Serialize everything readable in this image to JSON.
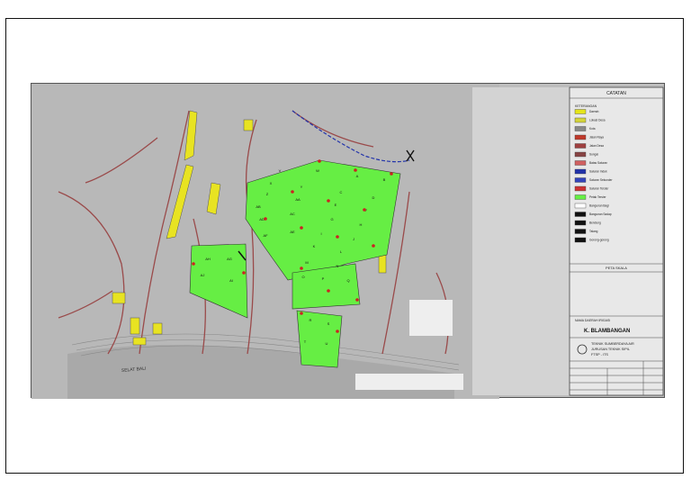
{
  "legend": {
    "title": "CATATAN",
    "subtitle": "KETERANGAN",
    "items": [
      {
        "label": "Daerah",
        "color": "#e5e51a"
      },
      {
        "label": "Lokasi Desa",
        "color": "#d4d43a"
      },
      {
        "label": "Kota",
        "color": "#888888"
      },
      {
        "label": "Jalan Raya",
        "color": "#c0392b"
      },
      {
        "label": "Jalan Desa",
        "color": "#a04040"
      },
      {
        "label": "Sungai",
        "color": "#884444"
      },
      {
        "label": "Batas Saluran",
        "color": "#d06060"
      },
      {
        "label": "Saluran Induk",
        "color": "#2233aa"
      },
      {
        "label": "Saluran Sekunder",
        "color": "#3344bb"
      },
      {
        "label": "Saluran Tersier",
        "color": "#cc3333"
      },
      {
        "label": "Petak Tersier",
        "color": "#66ee44"
      },
      {
        "label": "Bangunan Bagi",
        "color": "#ffffff"
      },
      {
        "label": "Bangunan Sadap",
        "color": "#111111"
      },
      {
        "label": "Bendung",
        "color": "#111111"
      },
      {
        "label": "Talang",
        "color": "#111111"
      },
      {
        "label": "Gorong-gorong",
        "color": "#111111"
      }
    ]
  },
  "key_map_title": "PETA SKALA",
  "title_block": {
    "header": "NAMA DAERAH IRIGASI",
    "name": "K. BLAMBANGAN",
    "dept_line1": "TEKNIK SUMBERDAYA AIR",
    "dept_line2": "JURUSAN TEKNIK SIPIL",
    "dept_line3": "FTSP - ITS"
  },
  "sea_label": "SELAT   BALI",
  "blocks": [
    "V",
    "W",
    "A",
    "B",
    "X",
    "Y",
    "C",
    "D",
    "Z",
    "AA",
    "E",
    "F",
    "AB",
    "AC",
    "G",
    "H",
    "AD",
    "AE",
    "I",
    "J",
    "AF",
    "K",
    "L",
    "M",
    "N",
    "O",
    "P",
    "Q",
    "AH",
    "AG",
    "AJ",
    "AI",
    "R",
    "S",
    "T",
    "U"
  ],
  "colors": {
    "block_fill": "#66ee44",
    "yellow_area": "#e8e322",
    "river": "#9a4a4a",
    "canal": "#2233aa",
    "frame": "#111111",
    "scan_bg": "#bdbdbd"
  }
}
